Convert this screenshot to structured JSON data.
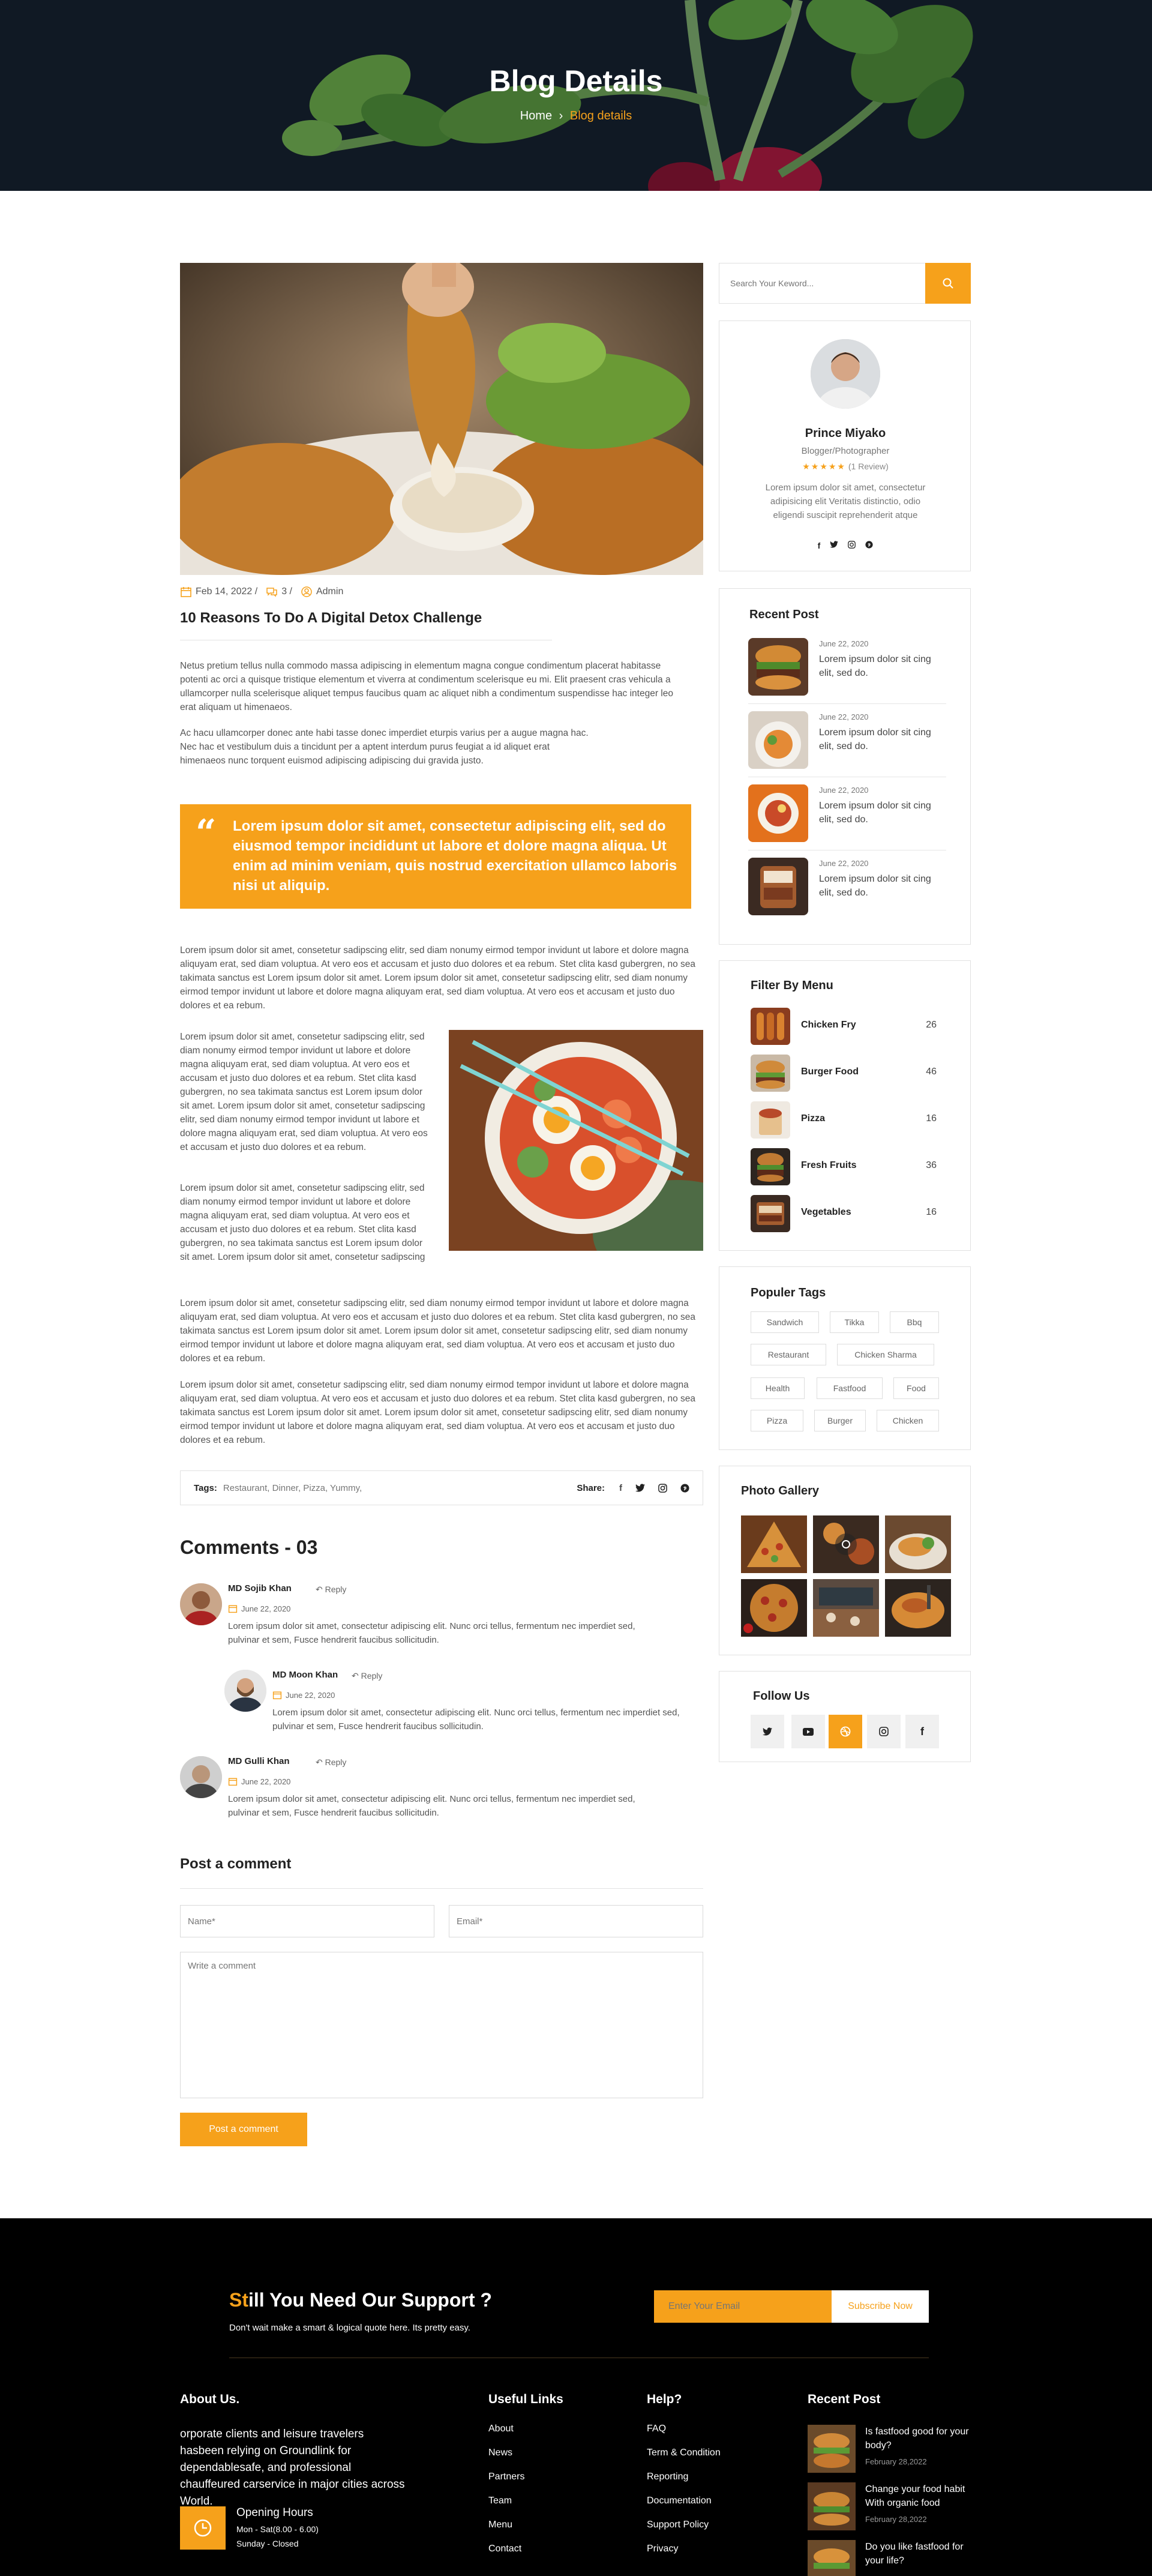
{
  "hero": {
    "title": "Blog Details",
    "crumb_home": "Home",
    "crumb_sep": "›",
    "crumb_current": "Blog details"
  },
  "post": {
    "date": "Feb 14, 2022 /",
    "comments": "3 /",
    "author": "Admin",
    "title": "10 Reasons To Do A Digital Detox Challenge",
    "para1": "Netus pretium tellus nulla commodo massa adipiscing in elementum magna congue condimentum placerat habitasse potenti ac orci a quisque tristique elementum et viverra at condimentum scelerisque eu mi. Elit praesent cras vehicula a ullamcorper nulla scelerisque aliquet tempus faucibus quam ac aliquet nibh a condimentum suspendisse hac integer leo erat aliquam ut himenaeos.",
    "para2a": "Ac hacu ullamcorper donec ante habi tasse donec imperdiet eturpis varius per a augue magna hac.",
    "para2b": "Nec hac et vestibulum duis a tincidunt per a aptent interdum purus feugiat a id aliquet erat",
    "para2c": "himenaeos nunc torquent euismod adipiscing adipiscing dui gravida justo.",
    "quote_mark": "“",
    "quote": "Lorem ipsum dolor sit amet, consectetur adipiscing elit, sed do eiusmod tempor incididunt ut labore et dolore magna aliqua. Ut enim ad minim veniam, quis nostrud exercitation ullamco laboris nisi ut aliquip.",
    "para3": "Lorem ipsum dolor sit amet, consetetur sadipscing elitr, sed diam nonumy eirmod tempor invidunt ut labore et dolore magna aliquyam erat, sed diam voluptua. At vero eos et accusam et justo duo dolores et ea rebum. Stet clita kasd gubergren, no sea takimata sanctus est Lorem ipsum dolor sit amet. Lorem ipsum dolor sit amet, consetetur sadipscing elitr, sed diam nonumy eirmod tempor invidunt ut labore et dolore magna aliquyam erat, sed diam voluptua. At vero eos et accusam et justo duo dolores et ea rebum.",
    "para4": "Lorem ipsum dolor sit amet, consetetur sadipscing elitr, sed diam nonumy eirmod tempor invidunt ut labore et dolore magna aliquyam erat, sed diam voluptua. At vero eos et accusam et justo duo dolores et ea rebum. Stet clita kasd gubergren, no sea takimata sanctus est Lorem ipsum dolor sit amet. Lorem ipsum dolor sit amet, consetetur sadipscing elitr, sed diam nonumy eirmod tempor invidunt ut labore et dolore magna aliquyam erat, sed diam voluptua. At vero eos et accusam et justo duo dolores et ea rebum.",
    "para5": "Lorem ipsum dolor sit amet, consetetur sadipscing elitr, sed diam nonumy eirmod tempor invidunt ut labore et dolore magna aliquyam erat, sed diam voluptua. At vero eos et accusam et justo duo dolores et ea rebum. Stet clita kasd gubergren, no sea takimata sanctus est Lorem ipsum dolor sit amet. Lorem ipsum dolor sit amet, consetetur sadipscing",
    "para6": "Lorem ipsum dolor sit amet, consetetur sadipscing elitr, sed diam nonumy eirmod tempor invidunt ut labore et dolore magna aliquyam erat, sed diam voluptua. At vero eos et accusam et justo duo dolores et ea rebum. Stet clita kasd gubergren, no sea takimata sanctus est Lorem ipsum dolor sit amet. Lorem ipsum dolor sit amet, consetetur sadipscing elitr, sed diam nonumy eirmod tempor invidunt ut labore et dolore magna aliquyam erat, sed diam voluptua. At vero eos et accusam et justo duo dolores et ea rebum.",
    "para7": "Lorem ipsum dolor sit amet, consetetur sadipscing elitr, sed diam nonumy eirmod tempor invidunt ut labore et dolore magna aliquyam erat, sed diam voluptua. At vero eos et accusam et justo duo dolores et ea rebum. Stet clita kasd gubergren, no sea takimata sanctus est Lorem ipsum dolor sit amet. Lorem ipsum dolor sit amet, consetetur sadipscing elitr, sed diam nonumy eirmod tempor invidunt ut labore et dolore magna aliquyam erat, sed diam voluptua. At vero eos et accusam et justo duo dolores et ea rebum.",
    "tags_label": "Tags:",
    "tags": "Restaurant, Dinner, Pizza, Yummy,",
    "share_label": "Share:"
  },
  "comments": {
    "title": "Comments - 03",
    "reply_label": "Reply",
    "items": [
      {
        "name": "MD Sojib Khan",
        "date": "June 22, 2020",
        "text": "Lorem ipsum dolor sit amet, consectetur adipiscing elit. Nunc orci tellus, fermentum nec imperdiet sed, pulvinar et sem, Fusce hendrerit faucibus sollicitudin."
      },
      {
        "name": "MD Moon Khan",
        "date": "June 22, 2020",
        "text": "Lorem ipsum dolor sit amet, consectetur adipiscing elit. Nunc orci tellus, fermentum nec imperdiet sed, pulvinar et sem, Fusce hendrerit faucibus sollicitudin."
      },
      {
        "name": "MD Gulli Khan",
        "date": "June 22, 2020",
        "text": "Lorem ipsum dolor sit amet, consectetur adipiscing elit. Nunc orci tellus, fermentum nec imperdiet sed, pulvinar et sem, Fusce hendrerit faucibus sollicitudin."
      }
    ]
  },
  "form": {
    "title": "Post a comment",
    "name_placeholder": "Name*",
    "email_placeholder": "Email*",
    "comment_placeholder": "Write a comment",
    "submit": "Post a comment"
  },
  "sidebar": {
    "search_placeholder": "Search Your Keword...",
    "profile": {
      "name": "Prince Miyako",
      "role": "Blogger/Photographer",
      "stars": "★★★★★",
      "rating": 5,
      "reviews": "(1 Review)",
      "bio": "Lorem ipsum dolor sit amet, consectetur adipisicing elit Veritatis distinctio, odio eligendi suscipit reprehenderit atque"
    },
    "recent": {
      "title": "Recent Post",
      "items": [
        {
          "date": "June 22, 2020",
          "text": "Lorem ipsum dolor sit cing elit, sed do."
        },
        {
          "date": "June 22, 2020",
          "text": "Lorem ipsum dolor sit cing elit, sed do."
        },
        {
          "date": "June 22, 2020",
          "text": "Lorem ipsum dolor sit cing elit, sed do."
        },
        {
          "date": "June 22, 2020",
          "text": "Lorem ipsum dolor sit cing elit, sed do."
        }
      ]
    },
    "filter": {
      "title": "Filter By Menu",
      "items": [
        {
          "name": "Chicken Fry",
          "count": "26"
        },
        {
          "name": "Burger Food",
          "count": "46"
        },
        {
          "name": "Pizza",
          "count": "16"
        },
        {
          "name": "Fresh Fruits",
          "count": "36"
        },
        {
          "name": "Vegetables",
          "count": "16"
        }
      ]
    },
    "tags": {
      "title": "Populer Tags",
      "items": [
        "Sandwich",
        "Tikka",
        "Bbq",
        "Restaurant",
        "Chicken Sharma",
        "Health",
        "Fastfood",
        "Food",
        "Pizza",
        "Burger",
        "Chicken"
      ]
    },
    "gallery": {
      "title": "Photo Gallery"
    },
    "follow": {
      "title": "Follow Us"
    }
  },
  "footer": {
    "support_title_hl": "St",
    "support_title_rest": "ill You Need Our Support ?",
    "support_sub": "Don't wait make a smart & logical quote here. Its pretty easy.",
    "email_placeholder": "Enter Your Email",
    "subscribe": "Subscribe Now",
    "about_title": "About Us.",
    "about_text": "orporate clients and leisure travelers hasbeen relying on Groundlink for dependablesafe, and professional chauffeured carservice in major cities across World.",
    "hours_title": "Opening Hours",
    "hours_1": "Mon - Sat(8.00 - 6.00)",
    "hours_2": "Sunday - Closed",
    "useful_title": "Useful Links",
    "useful": [
      "About",
      "News",
      "Partners",
      "Team",
      "Menu",
      "Contact"
    ],
    "help_title": "Help?",
    "help": [
      "FAQ",
      "Term & Condition",
      "Reporting",
      "Documentation",
      "Support Policy",
      "Privacy"
    ],
    "recent_title": "Recent Post",
    "recent": [
      {
        "title": "Is fastfood good for your body?",
        "date": "February 28,2022"
      },
      {
        "title": "Change your food habit With organic food",
        "date": "February 28,2022"
      },
      {
        "title": "Do you like fastfood for your life?",
        "date": ""
      }
    ]
  },
  "colors": {
    "accent": "#f6a11b",
    "dark": "#111b26",
    "footer": "#000000"
  }
}
